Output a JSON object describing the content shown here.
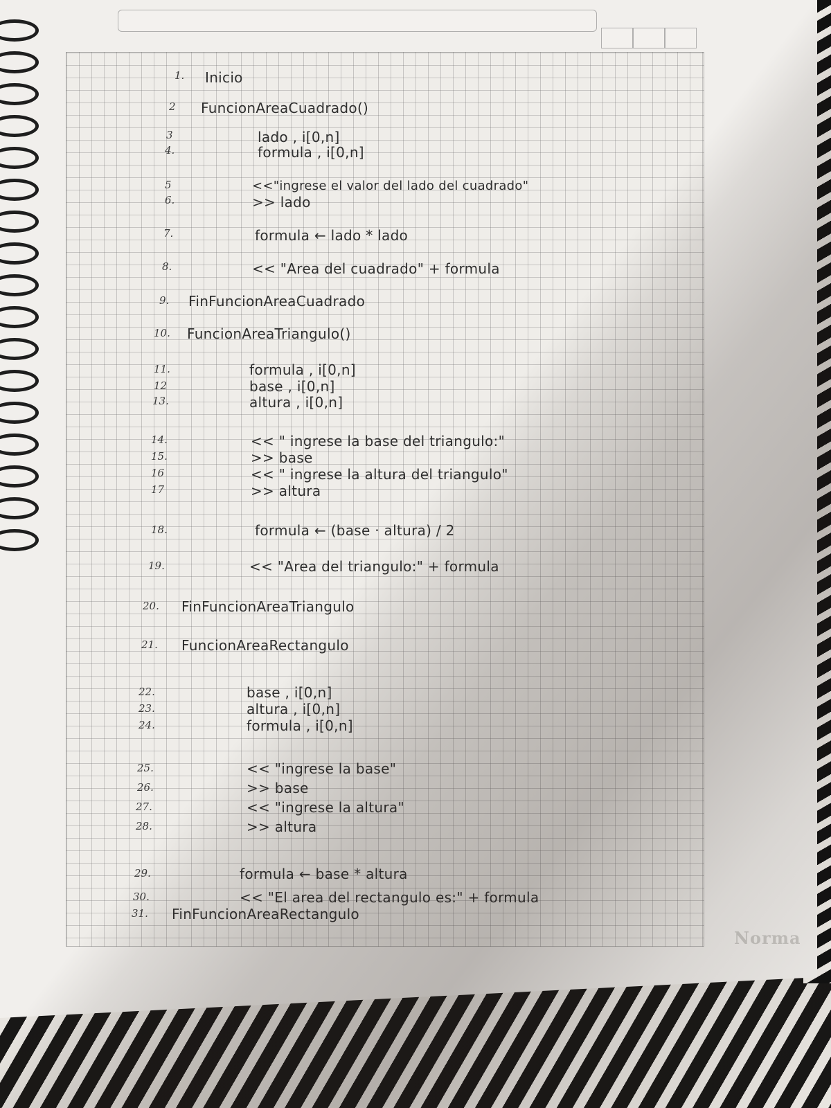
{
  "page": {
    "brand": "Norma",
    "lines": [
      {
        "n": "1.",
        "text": "Inicio"
      },
      {
        "n": "2",
        "text": "FuncionAreaCuadrado()"
      },
      {
        "n": "3",
        "text": "lado , i[0,n]"
      },
      {
        "n": "4.",
        "text": "formula , i[0,n]"
      },
      {
        "n": "5",
        "text": "<<\"ingrese el valor del lado del cuadrado\""
      },
      {
        "n": "6.",
        "text": ">> lado"
      },
      {
        "n": "7.",
        "text": "formula ← lado * lado"
      },
      {
        "n": "8.",
        "text": "<< \"Area del cuadrado\" + formula"
      },
      {
        "n": "9.",
        "text": "FinFuncionAreaCuadrado"
      },
      {
        "n": "10.",
        "text": "FuncionAreaTriangulo()"
      },
      {
        "n": "11.",
        "text": "formula , i[0,n]"
      },
      {
        "n": "12",
        "text": "base , i[0,n]"
      },
      {
        "n": "13.",
        "text": "altura , i[0,n]"
      },
      {
        "n": "14.",
        "text": "<< \" ingrese la base del triangulo:\""
      },
      {
        "n": "15.",
        "text": ">> base"
      },
      {
        "n": "16",
        "text": "<< \" ingrese la altura del triangulo\""
      },
      {
        "n": "17",
        "text": ">> altura"
      },
      {
        "n": "18.",
        "text": "formula ← (base · altura) / 2"
      },
      {
        "n": "19.",
        "text": "<< \"Area del triangulo:\" + formula"
      },
      {
        "n": "20.",
        "text": "FinFuncionAreaTriangulo"
      },
      {
        "n": "21.",
        "text": "FuncionAreaRectangulo"
      },
      {
        "n": "22.",
        "text": "base , i[0,n]"
      },
      {
        "n": "23.",
        "text": "altura , i[0,n]"
      },
      {
        "n": "24.",
        "text": "formula , i[0,n]"
      },
      {
        "n": "25.",
        "text": "<< \"ingrese la base\""
      },
      {
        "n": "26.",
        "text": ">> base"
      },
      {
        "n": "27.",
        "text": "<< \"ingrese la altura\""
      },
      {
        "n": "28.",
        "text": ">> altura"
      },
      {
        "n": "29.",
        "text": "formula ← base * altura"
      },
      {
        "n": "30.",
        "text": "<< \"El area del rectangulo es:\" + formula"
      },
      {
        "n": "31.",
        "text": "FinFuncionAreaRectangulo"
      }
    ]
  }
}
